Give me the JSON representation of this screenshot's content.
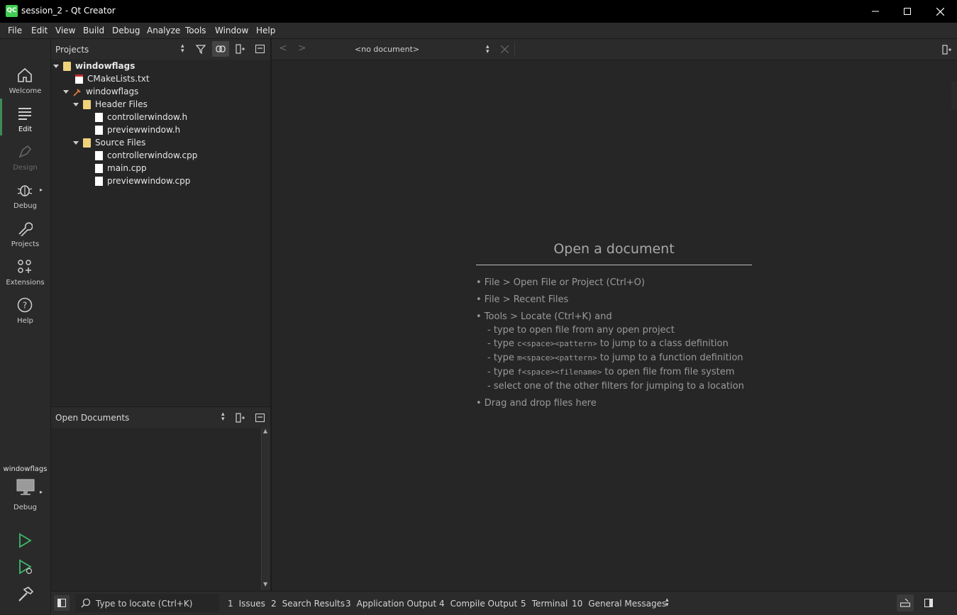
{
  "window": {
    "title": "session_2 - Qt Creator",
    "app_icon_text": "QC"
  },
  "menu": [
    "File",
    "Edit",
    "View",
    "Build",
    "Debug",
    "Analyze",
    "Tools",
    "Window",
    "Help"
  ],
  "modes": {
    "welcome": "Welcome",
    "edit": "Edit",
    "design": "Design",
    "debug": "Debug",
    "projects": "Projects",
    "extensions": "Extensions",
    "help": "Help"
  },
  "kit": {
    "project": "windowflags",
    "build": "Debug"
  },
  "projects_pane": {
    "title": "Projects",
    "tree": [
      "windowflags",
      "CMakeLists.txt",
      "windowflags",
      "Header Files",
      "controllerwindow.h",
      "previewwindow.h",
      "Source Files",
      "controllerwindow.cpp",
      "main.cpp",
      "previewwindow.cpp"
    ]
  },
  "open_documents": {
    "title": "Open Documents"
  },
  "editor": {
    "document_selector": "<no document>",
    "heading": "Open a document",
    "hints": {
      "h1": "• File > Open File or Project (Ctrl+O)",
      "h2": "• File > Recent Files",
      "h3": "• Tools > Locate (Ctrl+K) and",
      "h4": "- type to open file from any open project",
      "h5_pre": "- type ",
      "h5_code": "c<space><pattern>",
      "h5_post": " to jump to a class definition",
      "h6_pre": "- type ",
      "h6_code": "m<space><pattern>",
      "h6_post": " to jump to a function definition",
      "h7_pre": "- type ",
      "h7_code": "f<space><filename>",
      "h7_post": " to open file from file system",
      "h8": "- select one of the other filters for jumping to a location",
      "h9": "• Drag and drop files here"
    }
  },
  "statusbar": {
    "locator_placeholder": "Type to locate (Ctrl+K)",
    "tabs": [
      {
        "num": "1",
        "label": "Issues"
      },
      {
        "num": "2",
        "label": "Search Results"
      },
      {
        "num": "3",
        "label": "Application Output"
      },
      {
        "num": "4",
        "label": "Compile Output"
      },
      {
        "num": "5",
        "label": "Terminal"
      },
      {
        "num": "10",
        "label": "General Messages"
      }
    ]
  }
}
